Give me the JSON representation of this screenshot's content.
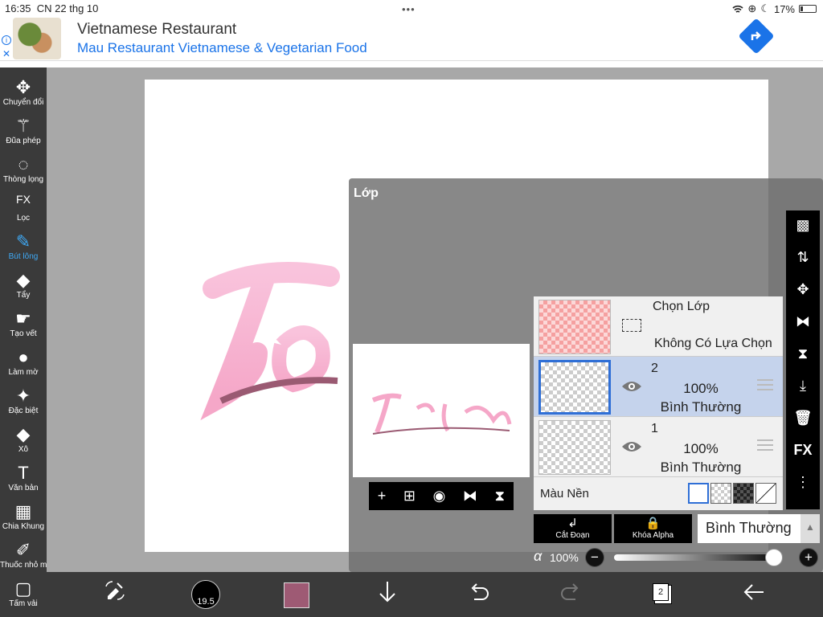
{
  "status_bar": {
    "time": "16:35",
    "date": "CN 22 thg 10",
    "battery": "17%",
    "battery_level": 0.17
  },
  "ad": {
    "info_glyph": "i",
    "close_glyph": "✕",
    "title": "Vietnamese Restaurant",
    "subtitle": "Mau Restaurant Vietnamese & Vegetarian Food",
    "direction_icon": "directions-arrow-icon"
  },
  "tools": [
    {
      "label": "Chuyển đổi",
      "icon": "move-icon",
      "glyph": "✥",
      "active": false
    },
    {
      "label": "Đũa phép",
      "icon": "magic-wand-icon",
      "glyph": "⚚",
      "active": false
    },
    {
      "label": "Thòng lọng",
      "icon": "lasso-icon",
      "glyph": "◌",
      "active": false
    },
    {
      "label": "Lọc",
      "icon": "fx-filter-icon",
      "glyph": "FX",
      "active": false
    },
    {
      "label": "Bút lông",
      "icon": "brush-icon",
      "glyph": "✎",
      "active": true
    },
    {
      "label": "Tẩy",
      "icon": "eraser-icon",
      "glyph": "◆",
      "active": false
    },
    {
      "label": "Tạo vết",
      "icon": "smudge-icon",
      "glyph": "☛",
      "active": false
    },
    {
      "label": "Làm mờ",
      "icon": "blur-drop-icon",
      "glyph": "●",
      "active": false
    },
    {
      "label": "Đặc biệt",
      "icon": "sparkle-icon",
      "glyph": "✦",
      "active": false
    },
    {
      "label": "Xô",
      "icon": "bucket-icon",
      "glyph": "◆",
      "active": false
    },
    {
      "label": "Văn bản",
      "icon": "text-icon",
      "glyph": "T",
      "active": false
    },
    {
      "label": "Chia Khung",
      "icon": "frame-divider-icon",
      "glyph": "▦",
      "active": false
    },
    {
      "label": "Thuốc nhỏ mắt",
      "icon": "eyedropper-icon",
      "glyph": "✐",
      "active": false
    },
    {
      "label": "Tấm vải",
      "icon": "canvas-icon",
      "glyph": "▢",
      "active": false
    }
  ],
  "layer_panel": {
    "title": "Lớp",
    "selection_layer": {
      "title": "Chọn Lớp",
      "status": "Không Có Lựa Chọn"
    },
    "layers": [
      {
        "name": "2",
        "opacity": "100%",
        "mode": "Bình Thường",
        "selected": true
      },
      {
        "name": "1",
        "opacity": "100%",
        "mode": "Bình Thường",
        "selected": false
      }
    ],
    "background": {
      "label": "Màu Nền",
      "swatches": [
        "white",
        "checker",
        "dark-checker",
        "none"
      ]
    },
    "clip_button": {
      "label": "Cắt Đoạn",
      "icon": "clip-arrow-icon",
      "glyph": "↲"
    },
    "alpha_lock_button": {
      "label": "Khóa Alpha",
      "icon": "lock-alpha-icon",
      "glyph": "🔒"
    },
    "blend_mode": "Bình Thường",
    "blend_arrow": "▲",
    "alpha_symbol": "α",
    "alpha_value": "100%",
    "alpha_fraction": 1.0,
    "minus": "−",
    "plus": "+",
    "right_tools": [
      {
        "icon": "transparent-bg-icon",
        "glyph": "▩"
      },
      {
        "icon": "layer-transfer-icon",
        "glyph": "⇅"
      },
      {
        "icon": "move-layer-icon",
        "glyph": "✥"
      },
      {
        "icon": "flip-horizontal-icon",
        "glyph": "⧓"
      },
      {
        "icon": "flip-vertical-icon",
        "glyph": "⧗"
      },
      {
        "icon": "merge-down-icon",
        "glyph": "⤓"
      },
      {
        "icon": "trash-icon",
        "glyph": "🗑"
      },
      {
        "icon": "fx-icon",
        "glyph": "FX"
      },
      {
        "icon": "more-vertical-icon",
        "glyph": "⋮"
      }
    ],
    "preview_tools": [
      {
        "icon": "add-layer-icon",
        "glyph": "+"
      },
      {
        "icon": "duplicate-layer-icon",
        "glyph": "⊞"
      },
      {
        "icon": "camera-icon",
        "glyph": "◉"
      },
      {
        "icon": "flip-h-icon",
        "glyph": "⧓"
      },
      {
        "icon": "flip-v-icon",
        "glyph": "⧗"
      }
    ]
  },
  "bottom_bar": {
    "brush_size": "19.5",
    "current_color": "#9e5a74",
    "layer_count": "2"
  },
  "colors": {
    "toolbar": "#3a3a3a",
    "accent": "#3fa9f5",
    "selection": "#2f6fd6",
    "workspace": "#a8a8a8"
  }
}
